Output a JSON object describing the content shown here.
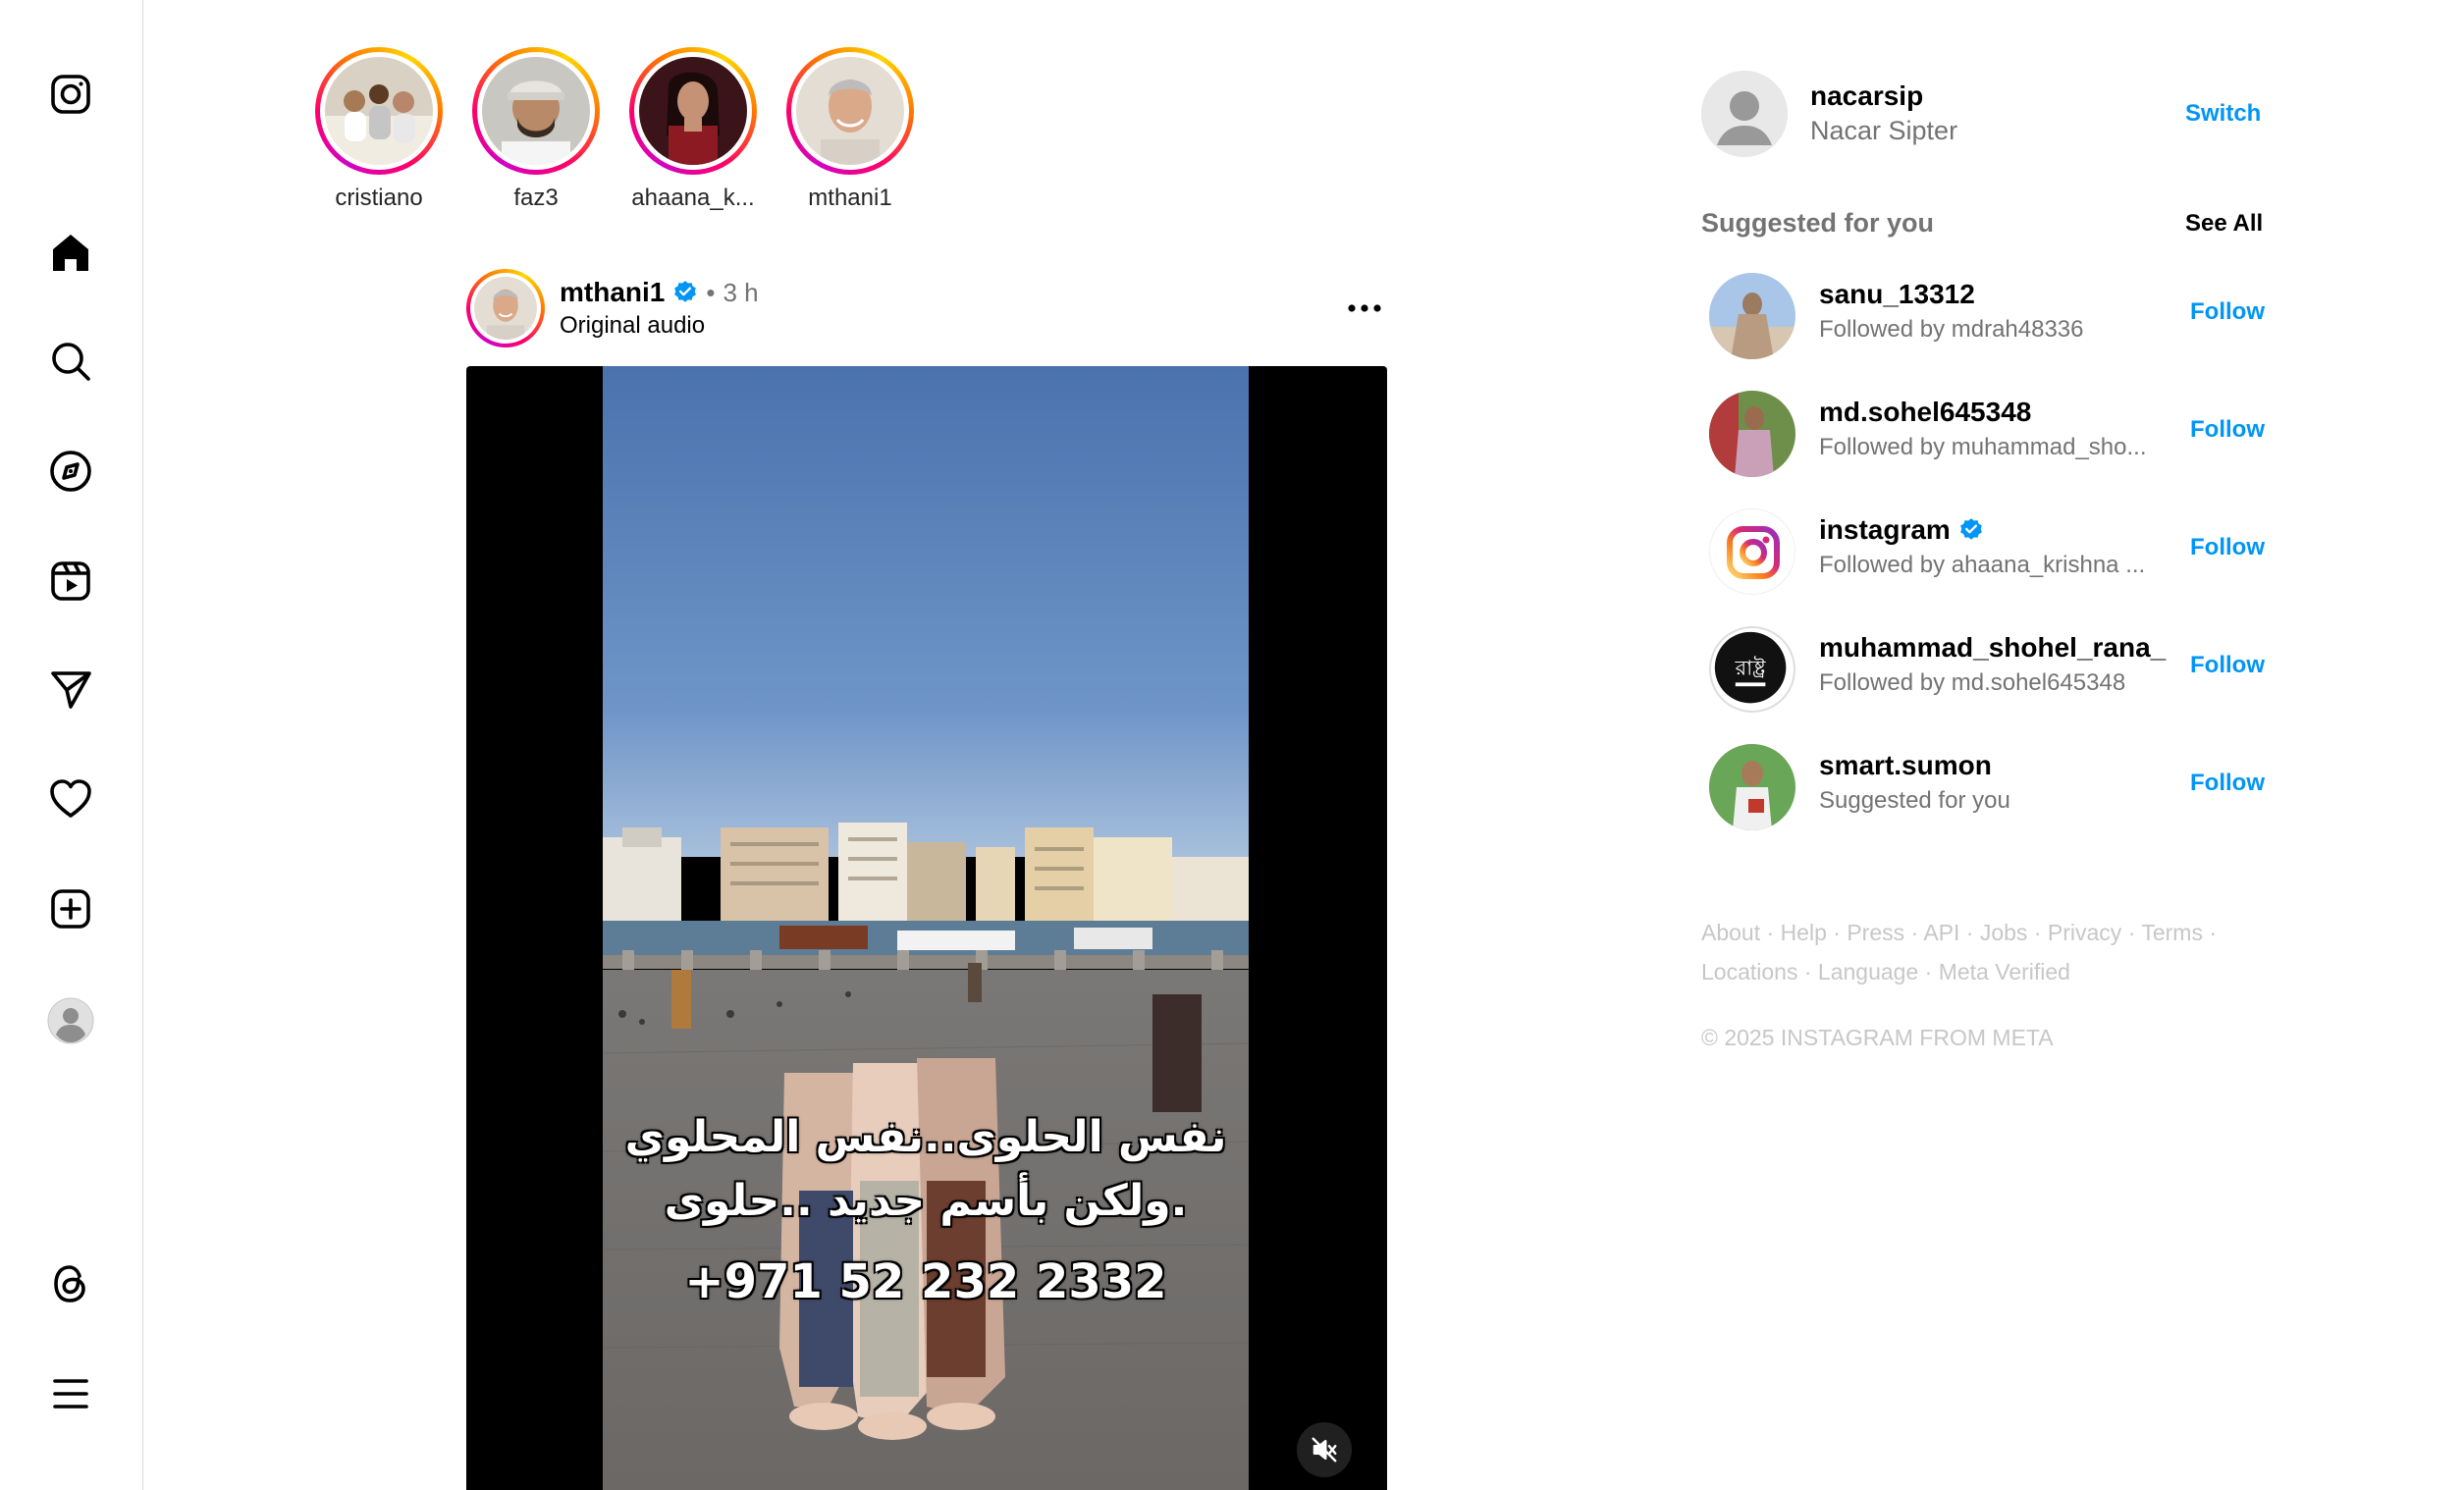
{
  "nav": {
    "items": [
      {
        "icon": "instagram-logo-icon"
      },
      {
        "icon": "home-icon"
      },
      {
        "icon": "search-icon"
      },
      {
        "icon": "explore-compass-icon"
      },
      {
        "icon": "reels-icon"
      },
      {
        "icon": "messages-send-icon"
      },
      {
        "icon": "notifications-heart-icon"
      },
      {
        "icon": "create-plus-icon"
      },
      {
        "icon": "profile-avatar-icon"
      },
      {
        "icon": "threads-icon"
      },
      {
        "icon": "more-menu-icon"
      }
    ]
  },
  "stories": [
    {
      "username": "cristiano"
    },
    {
      "username": "faz3"
    },
    {
      "username": "ahaana_k..."
    },
    {
      "username": "mthani1"
    }
  ],
  "post": {
    "username": "mthani1",
    "verified": true,
    "separator": "•",
    "time": "3 h",
    "audio": "Original audio",
    "overlay_line1": "نفس الحلوى..نفس المحلوي",
    "overlay_line2": "ولكن بأسم جديد ..حلوى.",
    "overlay_phone": "+971 52 232 2332",
    "muted": true
  },
  "account": {
    "username": "nacarsip",
    "full_name": "Nacar Sipter",
    "switch_label": "Switch"
  },
  "suggestions": {
    "title": "Suggested for you",
    "see_all": "See All",
    "items": [
      {
        "username": "sanu_13312",
        "subtitle": "Followed by mdrah48336",
        "follow": "Follow",
        "verified": false
      },
      {
        "username": "md.sohel645348",
        "subtitle": "Followed by muhammad_sho...",
        "follow": "Follow",
        "verified": false
      },
      {
        "username": "instagram",
        "subtitle": "Followed by ahaana_krishna ...",
        "follow": "Follow",
        "verified": true
      },
      {
        "username": "muhammad_shohel_rana_",
        "subtitle": "Followed by md.sohel645348",
        "follow": "Follow",
        "verified": false
      },
      {
        "username": "smart.sumon",
        "subtitle": "Suggested for you",
        "follow": "Follow",
        "verified": false
      }
    ]
  },
  "footer": {
    "links": [
      "About",
      "Help",
      "Press",
      "API",
      "Jobs",
      "Privacy",
      "Terms",
      "Locations",
      "Language",
      "Meta Verified"
    ],
    "separator": "·",
    "copyright": "© 2025 INSTAGRAM FROM META"
  },
  "colors": {
    "link_blue": "#0095f6",
    "secondary_text": "#737373",
    "footer_text": "#c7c7c7",
    "verified_blue": "#0095f6"
  }
}
